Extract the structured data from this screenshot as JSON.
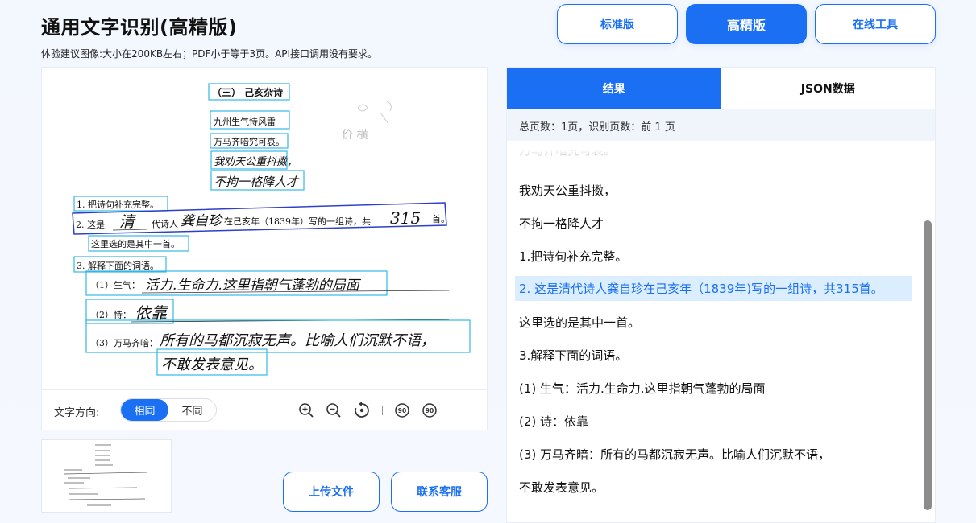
{
  "header": {
    "title": "通用文字识别(高精版)",
    "subtitle": "体验建议图像:大小在200KB左右；PDF小于等于3页。API接口调用没有要求。"
  },
  "modes": {
    "standard": "标准版",
    "high": "高精版",
    "online": "在线工具"
  },
  "toolbar": {
    "direction_label": "文字方向:",
    "same": "相同",
    "different": "不同"
  },
  "actions": {
    "upload": "上传文件",
    "contact": "联系客服"
  },
  "result": {
    "tab_result": "结果",
    "tab_json": "JSON数据",
    "page_info": "总页数：1页，识别页数：前 1 页",
    "partial_line": "万马齐喑究可哀。",
    "lines": [
      "我劝天公重抖擞，",
      "不拘一格降人才",
      "1.把诗句补充完整。",
      "2. 这是清代诗人龚自珍在己亥年（1839年)写的一组诗，共315首。",
      "这里选的是其中一首。",
      "3.解释下面的词语。",
      "(1) 生气：活力.生命力.这里指朝气蓬勃的局面",
      "(2) 诗：依靠",
      "(3) 万马齐暗：所有的马都沉寂无声。比喻人们沉默不语，",
      "不敢发表意见。"
    ]
  },
  "document": {
    "heading": "（三） 己亥杂诗",
    "poem_1": "九州生气恃风雷",
    "poem_2": "万马齐喑究可哀。",
    "poem_3": "我劝天公重抖擞，",
    "poem_4": "不拘一格降人才",
    "q1": "1. 把诗句补充完整。",
    "q2_a": "2. 这是",
    "q2_hw1": "清",
    "q2_b": "代诗人",
    "q2_hw2": "龚自珍",
    "q2_c": "在己亥年（1839年）写的一组诗，共",
    "q2_hw3": "315",
    "q2_d": "首。",
    "q2_line2": "这里选的是其中一首。",
    "q3": "3. 解释下面的词语。",
    "a1_label": "（1）生气：",
    "a1_hw": "活力.生命力.这里指朝气蓬勃的局面",
    "a2_label": "（2）恃：",
    "a2_hw": "依靠",
    "a3_label": "（3）万马齐喑：",
    "a3_hw": "所有的马都沉寂无声。比喻人们沉默不语，",
    "a3_hw2": "不敢发表意见。",
    "margin_note": "价 横"
  },
  "colors": {
    "accent": "#1b6ff2",
    "box": "#35b6e8",
    "box_selected": "#2f3fc7",
    "highlight_bg": "#dbeeff"
  },
  "icons": [
    "zoom-in-icon",
    "zoom-out-icon",
    "rotate-icon",
    "rotate-left-90-icon",
    "rotate-right-90-icon"
  ]
}
